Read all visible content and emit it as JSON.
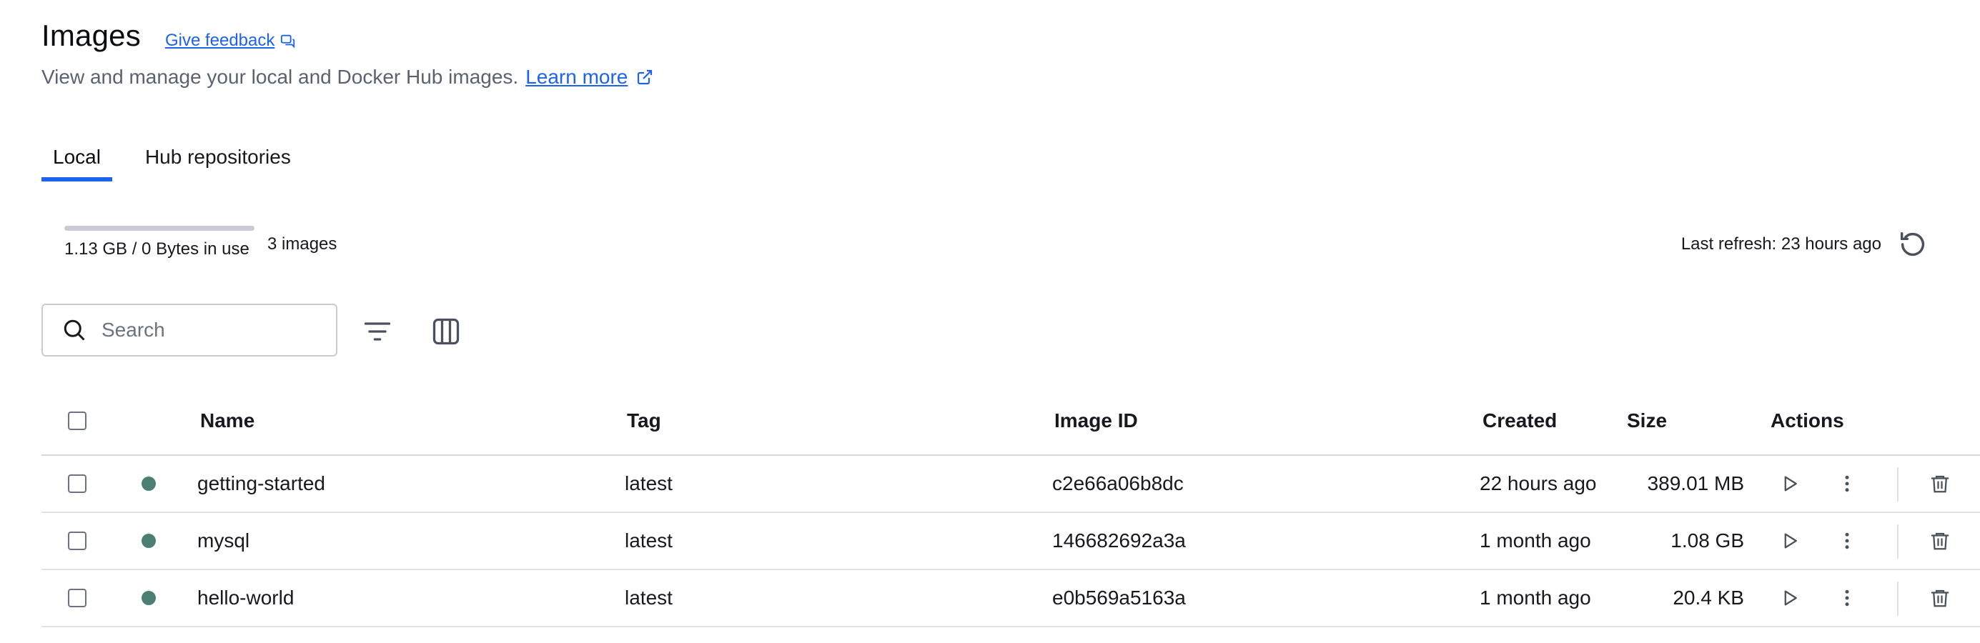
{
  "header": {
    "title": "Images",
    "feedback_label": "Give feedback",
    "subtitle": "View and manage your local and Docker Hub images.",
    "learn_more": "Learn more"
  },
  "tabs": [
    {
      "label": "Local",
      "active": true
    },
    {
      "label": "Hub repositories",
      "active": false
    }
  ],
  "usage": {
    "text": "1.13 GB / 0 Bytes in use",
    "fraction": 0,
    "count": "3 images"
  },
  "refresh": {
    "text": "Last refresh: 23 hours ago"
  },
  "search": {
    "placeholder": "Search"
  },
  "table": {
    "columns": {
      "name": "Name",
      "tag": "Tag",
      "image_id": "Image ID",
      "created": "Created",
      "size": "Size",
      "actions": "Actions"
    },
    "rows": [
      {
        "name": "getting-started",
        "tag": "latest",
        "image_id": "c2e66a06b8dc",
        "created": "22 hours ago",
        "size": "389.01 MB",
        "status_color": "#4b7f74"
      },
      {
        "name": "mysql",
        "tag": "latest",
        "image_id": "146682692a3a",
        "created": "1 month ago",
        "size": "1.08 GB",
        "status_color": "#4b7f74"
      },
      {
        "name": "hello-world",
        "tag": "latest",
        "image_id": "e0b569a5163a",
        "created": "1 month ago",
        "size": "20.4 KB",
        "status_color": "#4b7f74"
      }
    ]
  },
  "colors": {
    "accent": "#1d63ed",
    "status_in_use": "#4b7f74",
    "muted_text": "#5a6272"
  }
}
